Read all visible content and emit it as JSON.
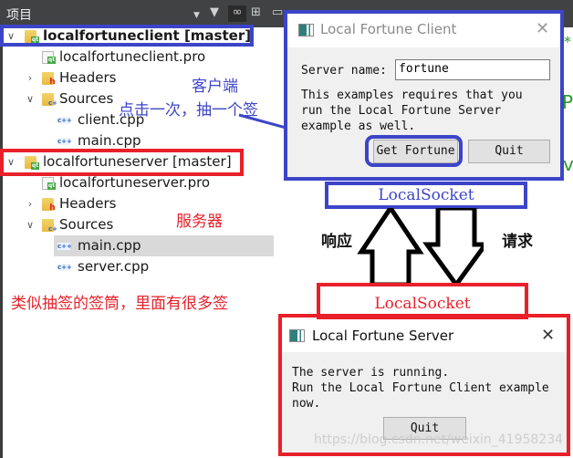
{
  "panel": {
    "title": "项目",
    "toolbar_icons": [
      "dropdown-icon",
      "filter-icon",
      "link-icon",
      "split-add-icon",
      "collapse-icon"
    ],
    "tree": [
      {
        "label": "localfortuneclient [master]",
        "type": "project",
        "expanded": true,
        "bold": true
      },
      {
        "label": "localfortuneclient.pro",
        "type": "pro-file"
      },
      {
        "label": "Headers",
        "type": "headers-folder",
        "expanded": false
      },
      {
        "label": "Sources",
        "type": "sources-folder",
        "expanded": true
      },
      {
        "label": "client.cpp",
        "type": "cpp-file"
      },
      {
        "label": "main.cpp",
        "type": "cpp-file"
      },
      {
        "label": "localfortuneserver [master]",
        "type": "project",
        "expanded": true,
        "bold": false
      },
      {
        "label": "localfortuneserver.pro",
        "type": "pro-file"
      },
      {
        "label": "Headers",
        "type": "headers-folder",
        "expanded": false
      },
      {
        "label": "Sources",
        "type": "sources-folder",
        "expanded": true
      },
      {
        "label": "main.cpp",
        "type": "cpp-file",
        "selected": true
      },
      {
        "label": "server.cpp",
        "type": "cpp-file"
      }
    ]
  },
  "annotations": {
    "client_label": "客户端",
    "click_hint": "点击一次，抽一个签",
    "server_label": "服务器",
    "server_hint": "类似抽签的签筒，里面有很多签",
    "response": "响应",
    "request": "请求",
    "client_socket": "LocalSocket",
    "server_socket": "LocalSocket"
  },
  "client_dialog": {
    "title": "Local Fortune Client",
    "server_name_label": "Server name:",
    "server_name_value": "fortune",
    "message": [
      "This examples requires that you",
      "run the Local Fortune Server",
      "example as well."
    ],
    "get_fortune_button": "Get Fortune",
    "quit_button": "Quit"
  },
  "server_dialog": {
    "title": "Local Fortune Server",
    "message": [
      "The server is running.",
      "Run the Local Fortune Client example",
      "now."
    ],
    "quit_button": "Quit"
  },
  "watermark": "https://blog.csdn.net/weixin_41958234",
  "colors": {
    "client_accent": "#3c45c8",
    "server_accent": "#e8202a"
  }
}
